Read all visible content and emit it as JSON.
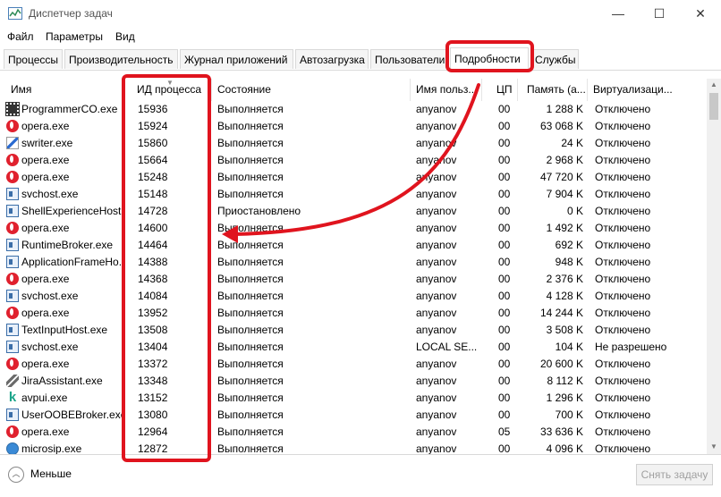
{
  "window": {
    "title": "Диспетчер задач",
    "minimize_icon": "—",
    "maximize_icon": "☐",
    "close_icon": "✕"
  },
  "menu": [
    "Файл",
    "Параметры",
    "Вид"
  ],
  "tabs": [
    {
      "label": "Процессы",
      "active": false
    },
    {
      "label": "Производительность",
      "active": false
    },
    {
      "label": "Журнал приложений",
      "active": false
    },
    {
      "label": "Автозагрузка",
      "active": false
    },
    {
      "label": "Пользователи",
      "active": false
    },
    {
      "label": "Подробности",
      "active": true
    },
    {
      "label": "Службы",
      "active": false
    }
  ],
  "columns": {
    "name": "Имя",
    "pid": "ИД процесса",
    "state": "Состояние",
    "user": "Имя польз...",
    "cpu": "ЦП",
    "mem": "Память (а...",
    "virt": "Виртуализаци..."
  },
  "rows": [
    {
      "icon": "film-icon",
      "name": "ProgrammerCO.exe",
      "pid": "15936",
      "state": "Выполняется",
      "user": "anyanov",
      "cpu": "00",
      "mem": "1 288 K",
      "virt": "Отключено"
    },
    {
      "icon": "opera-icon",
      "name": "opera.exe",
      "pid": "15924",
      "state": "Выполняется",
      "user": "anyanov",
      "cpu": "00",
      "mem": "63 068 K",
      "virt": "Отключено"
    },
    {
      "icon": "pen-icon",
      "name": "swriter.exe",
      "pid": "15860",
      "state": "Выполняется",
      "user": "anyanov",
      "cpu": "00",
      "mem": "24 K",
      "virt": "Отключено"
    },
    {
      "icon": "opera-icon",
      "name": "opera.exe",
      "pid": "15664",
      "state": "Выполняется",
      "user": "anyanov",
      "cpu": "00",
      "mem": "2 968 K",
      "virt": "Отключено"
    },
    {
      "icon": "opera-icon",
      "name": "opera.exe",
      "pid": "15248",
      "state": "Выполняется",
      "user": "anyanov",
      "cpu": "00",
      "mem": "47 720 K",
      "virt": "Отключено"
    },
    {
      "icon": "service-icon",
      "name": "svchost.exe",
      "pid": "15148",
      "state": "Выполняется",
      "user": "anyanov",
      "cpu": "00",
      "mem": "7 904 K",
      "virt": "Отключено"
    },
    {
      "icon": "service-icon",
      "name": "ShellExperienceHost...",
      "pid": "14728",
      "state": "Приостановлено",
      "user": "anyanov",
      "cpu": "00",
      "mem": "0 K",
      "virt": "Отключено"
    },
    {
      "icon": "opera-icon",
      "name": "opera.exe",
      "pid": "14600",
      "state": "Выполняется",
      "user": "anyanov",
      "cpu": "00",
      "mem": "1 492 K",
      "virt": "Отключено"
    },
    {
      "icon": "service-icon",
      "name": "RuntimeBroker.exe",
      "pid": "14464",
      "state": "Выполняется",
      "user": "anyanov",
      "cpu": "00",
      "mem": "692 K",
      "virt": "Отключено"
    },
    {
      "icon": "service-icon",
      "name": "ApplicationFrameHo...",
      "pid": "14388",
      "state": "Выполняется",
      "user": "anyanov",
      "cpu": "00",
      "mem": "948 K",
      "virt": "Отключено"
    },
    {
      "icon": "opera-icon",
      "name": "opera.exe",
      "pid": "14368",
      "state": "Выполняется",
      "user": "anyanov",
      "cpu": "00",
      "mem": "2 376 K",
      "virt": "Отключено"
    },
    {
      "icon": "service-icon",
      "name": "svchost.exe",
      "pid": "14084",
      "state": "Выполняется",
      "user": "anyanov",
      "cpu": "00",
      "mem": "4 128 K",
      "virt": "Отключено"
    },
    {
      "icon": "opera-icon",
      "name": "opera.exe",
      "pid": "13952",
      "state": "Выполняется",
      "user": "anyanov",
      "cpu": "00",
      "mem": "14 244 K",
      "virt": "Отключено"
    },
    {
      "icon": "service-icon",
      "name": "TextInputHost.exe",
      "pid": "13508",
      "state": "Выполняется",
      "user": "anyanov",
      "cpu": "00",
      "mem": "3 508 K",
      "virt": "Отключено"
    },
    {
      "icon": "service-icon",
      "name": "svchost.exe",
      "pid": "13404",
      "state": "Выполняется",
      "user": "LOCAL SE...",
      "cpu": "00",
      "mem": "104 K",
      "virt": "Не разрешено"
    },
    {
      "icon": "opera-icon",
      "name": "opera.exe",
      "pid": "13372",
      "state": "Выполняется",
      "user": "anyanov",
      "cpu": "00",
      "mem": "20 600 K",
      "virt": "Отключено"
    },
    {
      "icon": "jira-icon",
      "name": "JiraAssistant.exe",
      "pid": "13348",
      "state": "Выполняется",
      "user": "anyanov",
      "cpu": "00",
      "mem": "8 112 K",
      "virt": "Отключено"
    },
    {
      "icon": "k-icon",
      "name": "avpui.exe",
      "pid": "13152",
      "state": "Выполняется",
      "user": "anyanov",
      "cpu": "00",
      "mem": "1 296 K",
      "virt": "Отключено"
    },
    {
      "icon": "service-icon",
      "name": "UserOOBEBroker.exe",
      "pid": "13080",
      "state": "Выполняется",
      "user": "anyanov",
      "cpu": "00",
      "mem": "700 K",
      "virt": "Отключено"
    },
    {
      "icon": "opera-icon",
      "name": "opera.exe",
      "pid": "12964",
      "state": "Выполняется",
      "user": "anyanov",
      "cpu": "05",
      "mem": "33 636 K",
      "virt": "Отключено"
    },
    {
      "icon": "globe-icon",
      "name": "microsip.exe",
      "pid": "12872",
      "state": "Выполняется",
      "user": "anyanov",
      "cpu": "00",
      "mem": "4 096 K",
      "virt": "Отключено"
    }
  ],
  "footer": {
    "less_label": "Меньше",
    "end_task_label": "Снять задачу"
  },
  "annotation_color": "#e0141e"
}
